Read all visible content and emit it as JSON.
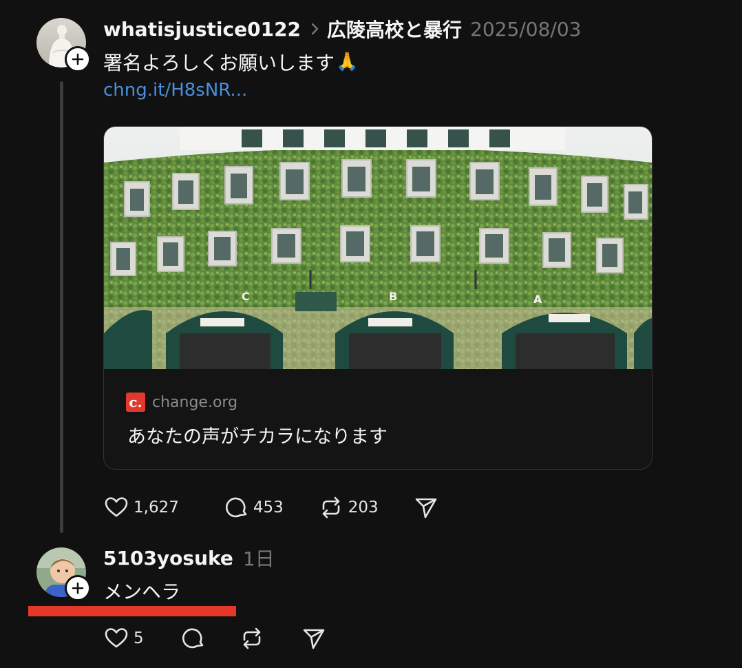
{
  "post": {
    "username": "whatisjustice0122",
    "topic": "広陵高校と暴行",
    "timestamp": "2025/08/03",
    "text": "署名よろしくお願いします",
    "emoji": "🙏",
    "link": "chng.it/H8sNR...",
    "link_card": {
      "image_alt": "阪神甲子園球場",
      "logo_letter": "c.",
      "domain": "change.org",
      "title": "あなたの声がチカラになります"
    },
    "actions": {
      "likes": "1,627",
      "replies": "453",
      "reposts": "203"
    }
  },
  "reply": {
    "username": "5103yosuke",
    "timestamp": "1日",
    "text": "メンヘラ",
    "actions": {
      "likes": "5"
    }
  },
  "colors": {
    "background": "#111111",
    "link": "#4a8fdc",
    "muted": "#777777",
    "annotation": "#e5372a",
    "brand_change_org": "#e2392d"
  },
  "icons": [
    "plus-icon",
    "chevron-right-icon",
    "heart-icon",
    "comment-icon",
    "repost-icon",
    "share-icon"
  ]
}
